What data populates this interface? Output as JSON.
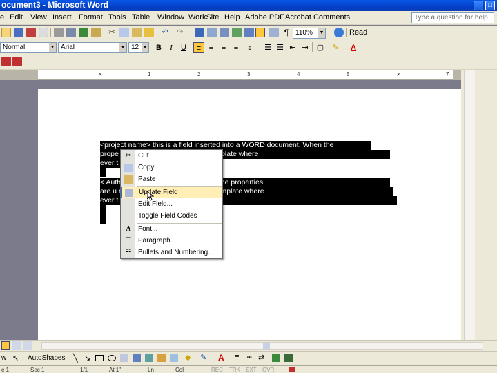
{
  "window": {
    "title": "ocument3 - Microsoft Word"
  },
  "menu": [
    "e",
    "Edit",
    "View",
    "Insert",
    "Format",
    "Tools",
    "Table",
    "Window",
    "WorkSite",
    "Help",
    "Adobe PDF",
    "Acrobat Comments"
  ],
  "help_placeholder": "Type a question for help",
  "toolbar": {
    "zoom": "110%",
    "read_label": "Read"
  },
  "formatting": {
    "style": "Normal",
    "font": "Arial",
    "size": "12"
  },
  "ruler": {
    "numbers": [
      "1",
      "2",
      "3",
      "4",
      "5",
      "6",
      "7"
    ]
  },
  "document": {
    "lines": [
      "<project name> this is a field inserted into a WORD document.  When the",
      "prope                                    ect name will appear in the template where",
      "ever t",
      "",
      "< Auth                                  to a WORD document.  When the properties",
      "are u                                   rrent author will appear in the template where",
      "ever t"
    ]
  },
  "context_menu": {
    "items": [
      {
        "label": "Cut",
        "icon": "scissors-icon"
      },
      {
        "label": "Copy",
        "icon": "copy-icon"
      },
      {
        "label": "Paste",
        "icon": "paste-icon"
      },
      {
        "label": "Update Field",
        "icon": "update-field-icon"
      },
      {
        "label": "Edit Field...",
        "icon": ""
      },
      {
        "label": "Toggle Field Codes",
        "icon": ""
      },
      {
        "label": "Font...",
        "icon": "font-icon"
      },
      {
        "label": "Paragraph...",
        "icon": "paragraph-icon"
      },
      {
        "label": "Bullets and Numbering...",
        "icon": "bullets-icon"
      }
    ]
  },
  "drawing": {
    "draw_label": "w",
    "autoshapes_label": "AutoShapes"
  },
  "status": {
    "page": "e 1",
    "sec": "Sec 1",
    "pos": "1/1",
    "at": "At 1\"",
    "ln": "Ln",
    "col": "Col",
    "rec": "REC",
    "trk": "TRK",
    "ext": "EXT",
    "ovr": "OVR"
  }
}
